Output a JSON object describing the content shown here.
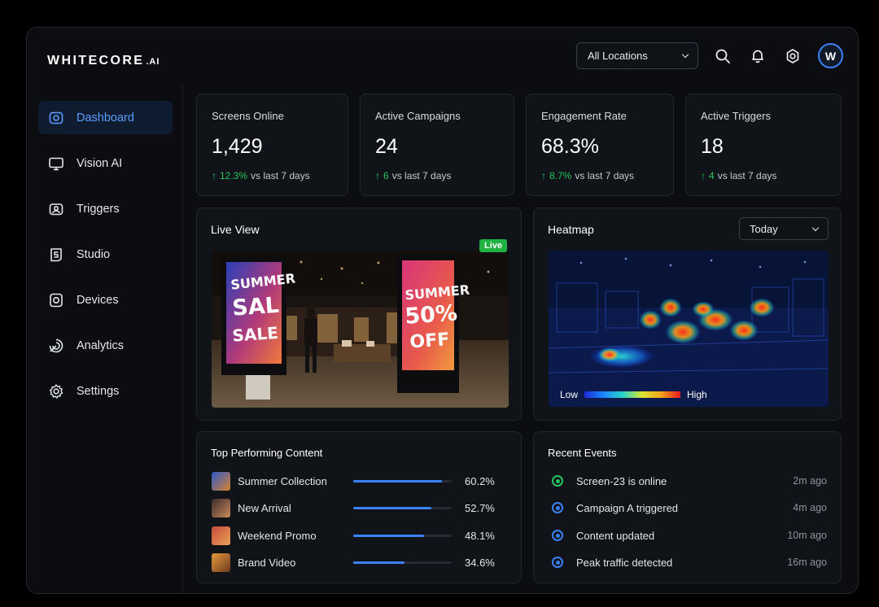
{
  "brand": {
    "name": "WHITECORE",
    "suffix": ".AI"
  },
  "header": {
    "location_select": "All Locations",
    "icons": [
      "search-icon",
      "bell-icon",
      "settings-icon"
    ],
    "avatar_initial": "W"
  },
  "sidebar": {
    "items": [
      {
        "label": "Dashboard",
        "icon": "dashboard-icon",
        "active": true
      },
      {
        "label": "Vision AI",
        "icon": "monitor-icon",
        "active": false
      },
      {
        "label": "Triggers",
        "icon": "trigger-icon",
        "active": false
      },
      {
        "label": "Studio",
        "icon": "studio-icon",
        "active": false
      },
      {
        "label": "Devices",
        "icon": "device-icon",
        "active": false
      },
      {
        "label": "Analytics",
        "icon": "analytics-icon",
        "active": false
      },
      {
        "label": "Settings",
        "icon": "gear-icon",
        "active": false
      }
    ]
  },
  "stats": [
    {
      "label": "Screens Online",
      "value": "1,429",
      "delta": "12.3%",
      "suffix": "vs last 7 days"
    },
    {
      "label": "Active Campaigns",
      "value": "24",
      "delta": "6",
      "suffix": "vs last 7 days"
    },
    {
      "label": "Engagement Rate",
      "value": "68.3%",
      "delta": "8.7%",
      "suffix": "vs last 7 days"
    },
    {
      "label": "Active Triggers",
      "value": "18",
      "delta": "4",
      "suffix": "vs last 7 days"
    }
  ],
  "live_view": {
    "title": "Live View",
    "badge": "Live",
    "sign_left": [
      "SUMMER",
      "SAL",
      "SALE"
    ],
    "sign_right": [
      "SUMMER",
      "50%",
      "OFF"
    ]
  },
  "heatmap": {
    "title": "Heatmap",
    "range_select": "Today",
    "legend_low": "Low",
    "legend_high": "High"
  },
  "top_content": {
    "title": "Top Performing Content",
    "items": [
      {
        "name": "Summer Collection",
        "percent": "60.2%",
        "fraction": 0.602
      },
      {
        "name": "New Arrival",
        "percent": "52.7%",
        "fraction": 0.527
      },
      {
        "name": "Weekend Promo",
        "percent": "48.1%",
        "fraction": 0.481
      },
      {
        "name": "Brand Video",
        "percent": "34.6%",
        "fraction": 0.346
      }
    ]
  },
  "recent_events": {
    "title": "Recent Events",
    "items": [
      {
        "text": "Screen-23 is online",
        "time": "2m ago",
        "status": "online",
        "color": "#22c55e"
      },
      {
        "text": "Campaign A triggered",
        "time": "4m ago",
        "status": "info",
        "color": "#3b82f6"
      },
      {
        "text": "Content updated",
        "time": "10m ago",
        "status": "info",
        "color": "#3b82f6"
      },
      {
        "text": "Peak traffic detected",
        "time": "16m ago",
        "status": "info",
        "color": "#3b82f6"
      }
    ]
  },
  "colors": {
    "accent": "#3b82f6",
    "positive": "#22c55e",
    "live": "#1fb141",
    "background": "#0b0d11"
  }
}
